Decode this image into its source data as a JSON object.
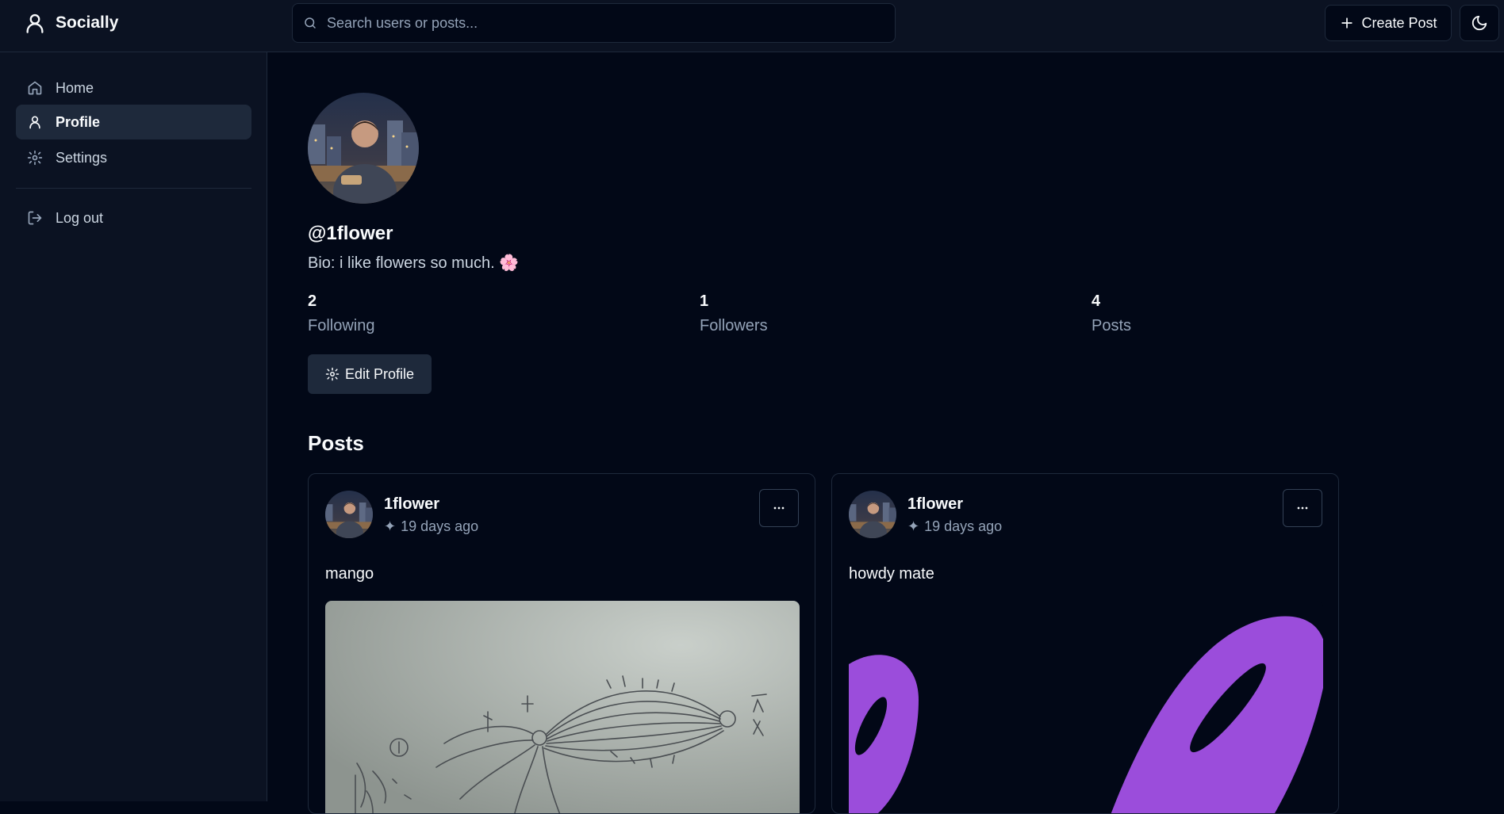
{
  "app": {
    "brand": "Socially",
    "search_placeholder": "Search users or posts...",
    "create_post_label": "Create Post",
    "icons": {
      "brand": "user-icon",
      "search": "search-icon",
      "create": "plus-icon",
      "theme": "moon-icon"
    }
  },
  "sidebar": {
    "items": [
      {
        "label": "Home",
        "icon": "home-icon",
        "active": false
      },
      {
        "label": "Profile",
        "icon": "user-icon",
        "active": true
      },
      {
        "label": "Settings",
        "icon": "gear-icon",
        "active": false
      },
      {
        "label": "Log out",
        "icon": "logout-icon",
        "active": false
      }
    ]
  },
  "profile": {
    "username": "@1flower",
    "bio": "Bio: i like flowers so much.",
    "bio_emoji": "🌸",
    "stats": [
      {
        "value": "2",
        "label": "Following"
      },
      {
        "value": "1",
        "label": "Followers"
      },
      {
        "value": "4",
        "label": "Posts"
      }
    ],
    "edit_label": "Edit Profile"
  },
  "posts_heading": "Posts",
  "posts": [
    {
      "author": "1flower",
      "time_icon": "✦",
      "time": "19 days ago",
      "text": "mango",
      "image": "hand-drawn-sketch"
    },
    {
      "author": "1flower",
      "time_icon": "✦",
      "time": "19 days ago",
      "text": "howdy mate",
      "image": "purple-rings"
    }
  ],
  "colors": {
    "background": "#020817",
    "sidebar": "#0b1222",
    "border": "#1e293b",
    "muted_text": "#94a3b8",
    "accent_purple": "#9b4ddb"
  }
}
